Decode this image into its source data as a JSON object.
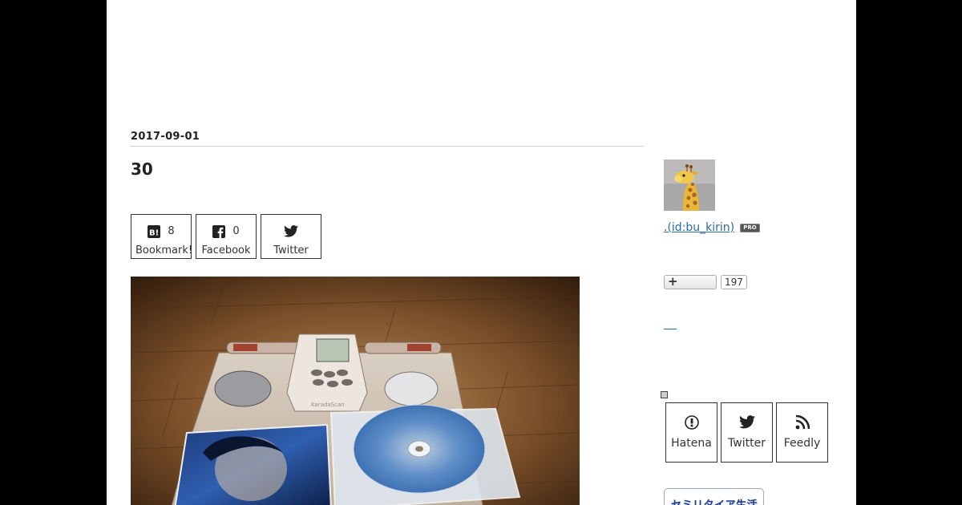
{
  "entry": {
    "date": "2017-09-01",
    "title": "30"
  },
  "share": {
    "bookmark": {
      "count": "8",
      "label": "Bookmark!"
    },
    "facebook": {
      "count": "0",
      "label": "Facebook"
    },
    "twitter": {
      "label": "Twitter"
    }
  },
  "sidebar": {
    "author": ".(id:bu_kirin)",
    "pro_badge": "PRO",
    "follow_count": "197",
    "subscribe": [
      {
        "label": "Hatena",
        "icon": "hatena-icon"
      },
      {
        "label": "Twitter",
        "icon": "twitter-icon"
      },
      {
        "label": "Feedly",
        "icon": "rss-icon"
      }
    ],
    "banner_text": "セミリタイア生活"
  },
  "colors": {
    "page_background": "#000000",
    "content_background": "#ffffff",
    "link": "#2a6aa6",
    "border": "#333333"
  }
}
